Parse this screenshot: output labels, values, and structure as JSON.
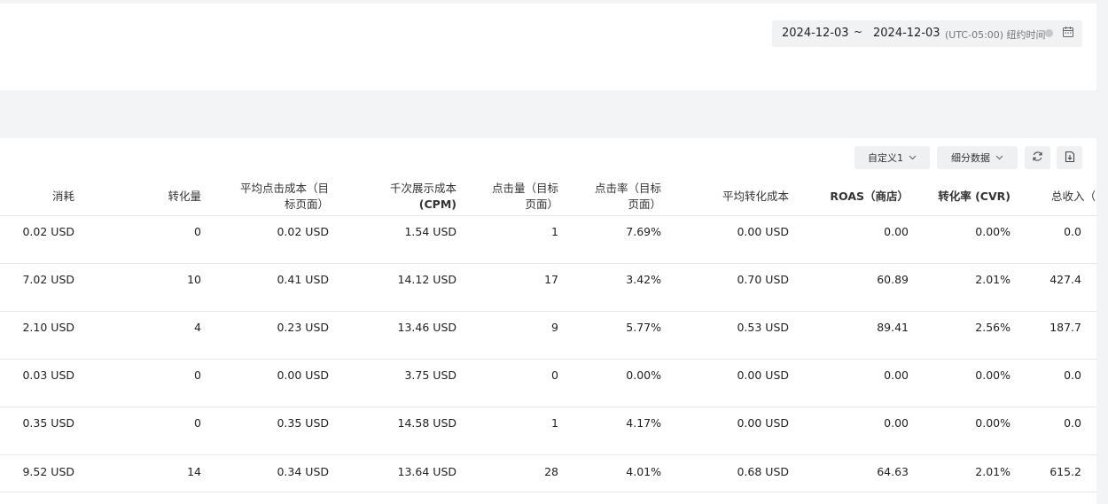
{
  "date_range": {
    "start": "2024-12-03",
    "separator": "~",
    "end": "2024-12-03",
    "timezone": "(UTC-05:00) 纽约时间"
  },
  "toolbar": {
    "custom_label": "自定义1",
    "breakdown_label": "细分数据"
  },
  "table": {
    "headers": [
      "消耗",
      "转化量",
      "平均点击成本（目\n标页面）",
      "千次展示成本\n(CPM)",
      "点击量（目标\n页面）",
      "点击率（目标\n页面）",
      "平均转化成本",
      "ROAS（商店）",
      "转化率 (CVR)",
      "总收入（"
    ],
    "rows": [
      [
        "0.02 USD",
        "0",
        "0.02 USD",
        "1.54 USD",
        "1",
        "7.69%",
        "0.00 USD",
        "0.00",
        "0.00%",
        "0.0"
      ],
      [
        "7.02 USD",
        "10",
        "0.41 USD",
        "14.12 USD",
        "17",
        "3.42%",
        "0.70 USD",
        "60.89",
        "2.01%",
        "427.4"
      ],
      [
        "2.10 USD",
        "4",
        "0.23 USD",
        "13.46 USD",
        "9",
        "5.77%",
        "0.53 USD",
        "89.41",
        "2.56%",
        "187.7"
      ],
      [
        "0.03 USD",
        "0",
        "0.00 USD",
        "3.75 USD",
        "0",
        "0.00%",
        "0.00 USD",
        "0.00",
        "0.00%",
        "0.0"
      ],
      [
        "0.35 USD",
        "0",
        "0.35 USD",
        "14.58 USD",
        "1",
        "4.17%",
        "0.00 USD",
        "0.00",
        "0.00%",
        "0.0"
      ],
      [
        "9.52 USD",
        "14",
        "0.34 USD",
        "13.64 USD",
        "28",
        "4.01%",
        "0.68 USD",
        "64.63",
        "2.01%",
        "615.2"
      ]
    ]
  },
  "icons": {
    "calendar": "calendar-icon",
    "refresh": "refresh-icon",
    "export": "export-icon",
    "info": "info-icon"
  }
}
